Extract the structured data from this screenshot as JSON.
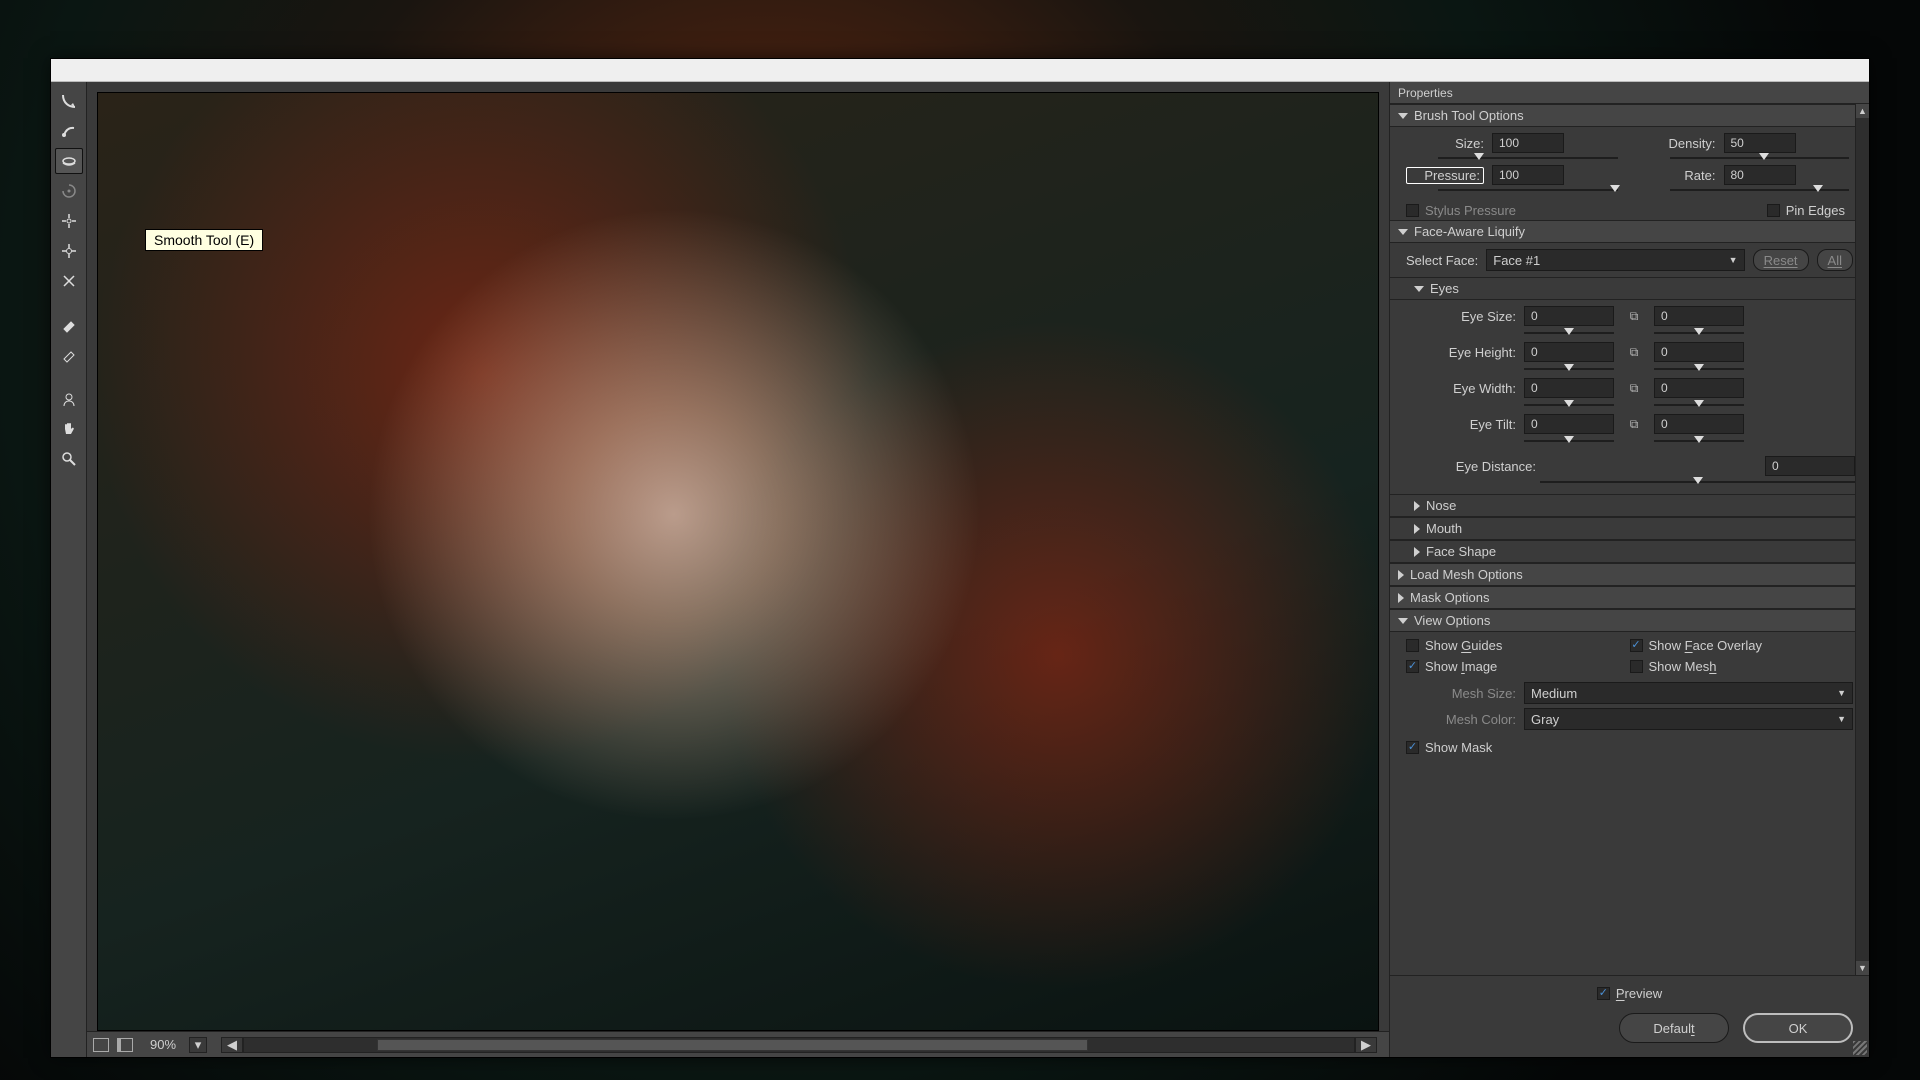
{
  "tooltip": "Smooth Tool (E)",
  "status": {
    "zoom": "90%"
  },
  "panel_title": "Properties",
  "brush": {
    "title": "Brush Tool Options",
    "size_label": "Size:",
    "size_value": "100",
    "density_label": "Density:",
    "density_value": "50",
    "pressure_label": "Pressure:",
    "pressure_value": "100",
    "rate_label": "Rate:",
    "rate_value": "80",
    "stylus_label": "Stylus Pressure",
    "pinedges_label": "Pin Edges"
  },
  "face": {
    "title": "Face-Aware Liquify",
    "select_label": "Select Face:",
    "select_value": "Face #1",
    "reset": "Reset",
    "all": "All"
  },
  "eyes": {
    "title": "Eyes",
    "size_label": "Eye Size:",
    "height_label": "Eye Height:",
    "width_label": "Eye Width:",
    "tilt_label": "Eye Tilt:",
    "distance_label": "Eye Distance:",
    "left": {
      "size": "0",
      "height": "0",
      "width": "0",
      "tilt": "0"
    },
    "right": {
      "size": "0",
      "height": "0",
      "width": "0",
      "tilt": "0"
    },
    "distance": "0"
  },
  "subsections": {
    "nose": "Nose",
    "mouth": "Mouth",
    "faceshape": "Face Shape"
  },
  "loadmesh": "Load Mesh Options",
  "maskopt": "Mask Options",
  "view": {
    "title": "View Options",
    "guides": "Show Guides",
    "image": "Show Image",
    "faceoverlay": "Show Face Overlay",
    "mesh": "Show Mesh",
    "meshsize_label": "Mesh Size:",
    "meshsize_value": "Medium",
    "meshcolor_label": "Mesh Color:",
    "meshcolor_value": "Gray",
    "showmask": "Show Mask"
  },
  "footer": {
    "preview": "Preview",
    "default": "Default",
    "ok": "OK"
  }
}
